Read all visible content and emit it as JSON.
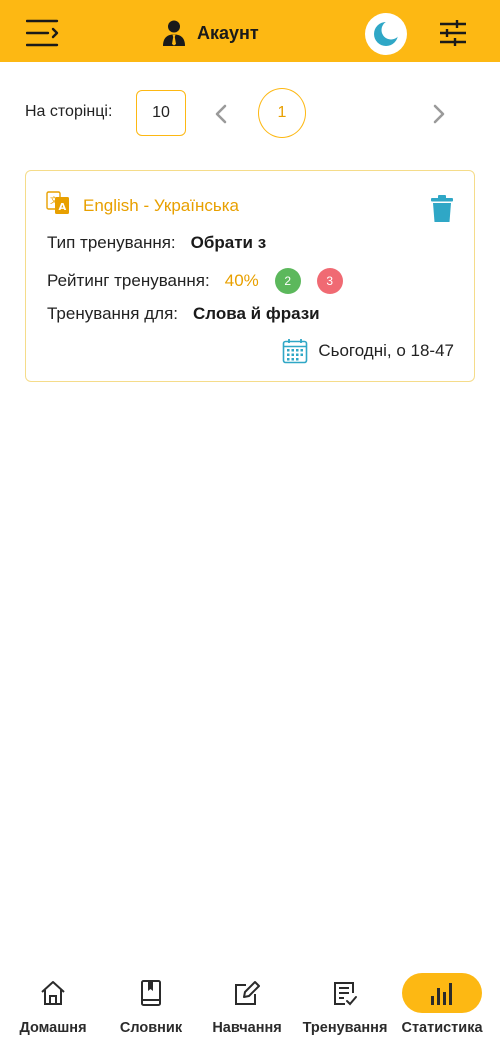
{
  "header": {
    "account_label": "Акаунт",
    "icons": {
      "menu": "menu-arrow-icon",
      "account": "user-tie-icon",
      "theme": "moon-icon",
      "settings": "sliders-icon"
    },
    "colors": {
      "bar": "#FDB813",
      "moon": "#2FA7C6"
    }
  },
  "pager": {
    "label": "На сторінці:",
    "page_size": "10",
    "current_page": "1"
  },
  "card": {
    "title": "English - Українська",
    "type_label": "Тип тренування:",
    "type_value": "Обрати з",
    "rating_label": "Рейтинг тренування:",
    "rating_value": "40%",
    "correct_count": "2",
    "wrong_count": "3",
    "for_label": "Тренування для:",
    "for_value": "Слова й фрази",
    "date": "Сьогодні, о 18-47",
    "colors": {
      "accent": "#E8A000",
      "trash": "#2FA7C6",
      "correct": "#5CB85C",
      "wrong": "#F06A73"
    }
  },
  "bottom_nav": {
    "items": [
      {
        "label": "Домашня",
        "icon": "home-icon"
      },
      {
        "label": "Словник",
        "icon": "book-icon"
      },
      {
        "label": "Навчання",
        "icon": "edit-icon"
      },
      {
        "label": "Тренування",
        "icon": "checklist-icon"
      },
      {
        "label": "Статистика",
        "icon": "bar-chart-icon",
        "active": true
      }
    ]
  }
}
